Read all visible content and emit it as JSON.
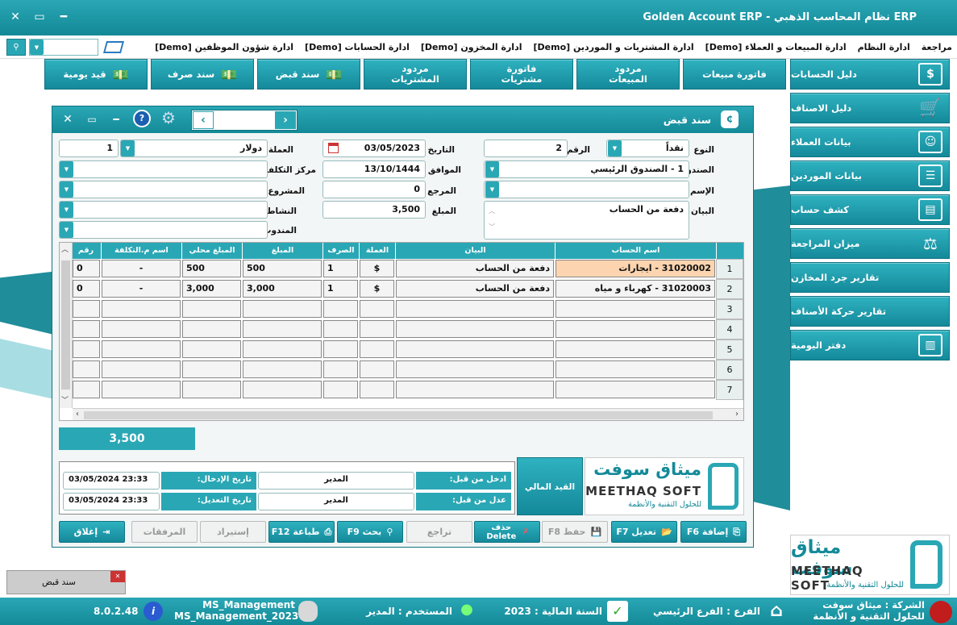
{
  "window": {
    "title": "ERP نظام المحاسب الذهبي - Golden Account ERP"
  },
  "menu": {
    "items": [
      "ادارة شؤون الموظفين [Demo]",
      "ادارة الحسابات [Demo]",
      "ادارة المخزون [Demo]",
      "ادارة المشتريات و الموردين [Demo]",
      "ادارة المبيعات و العملاء [Demo]",
      "ادارة النظام",
      "مراجعة"
    ]
  },
  "toolbar": {
    "tiles": [
      "فاتورة مبيعات",
      "مردود المبيعات",
      "فاتورة مشتريات",
      "مردود المشتريات",
      "سند قبض",
      "سند صرف",
      "قيد يومية"
    ]
  },
  "sidebar": {
    "items": [
      "دليل الحسابات",
      "دليل الاصناف",
      "بيانات العملاء",
      "بيانات الموردين",
      "كشف حساب",
      "ميزان المراجعة",
      "تقارير جرد المخازن",
      "تقارير حركة الأصناف",
      "دفتر اليومية"
    ]
  },
  "dialog": {
    "title": "سند قبض",
    "record_no": "2",
    "labels": {
      "type": "النوع",
      "number": "الرقم",
      "date": "التاريخ",
      "currency": "العملة",
      "box": "الصندوق",
      "hijri": "الموافق",
      "cost_center": "مركز التكلفة",
      "name": "الإسم",
      "ref": "المرجع",
      "project": "المشروع",
      "statement": "البيان",
      "amount": "المبلغ",
      "activity": "النشاط",
      "delegate": "المندوب"
    },
    "values": {
      "type": "نقداً",
      "number": "2",
      "date": "03/05/2023",
      "currency": "دولار",
      "currency_rate": "1",
      "box": "1 - الصندوق الرئيسي",
      "hijri": "13/10/1444",
      "ref": "0",
      "amount": "3,500",
      "statement": "دفعة من الحساب"
    },
    "grid": {
      "headers": [
        "اسم الحساب",
        "البيان",
        "العملة",
        "الصرف",
        "المبلغ",
        "المبلغ محلي",
        "اسم م.التكلفة",
        "رقم"
      ],
      "rows": [
        {
          "n": "1",
          "account": "31020002 - ايجارات",
          "statement": "دفعة من الحساب",
          "currency": "$",
          "rate": "1",
          "amount": "500",
          "local": "500",
          "cost": "-",
          "num": "0"
        },
        {
          "n": "2",
          "account": "31020003 - كهرباء و مياه",
          "statement": "دفعة من الحساب",
          "currency": "$",
          "rate": "1",
          "amount": "3,000",
          "local": "3,000",
          "cost": "-",
          "num": "0"
        },
        {
          "n": "3"
        },
        {
          "n": "4"
        },
        {
          "n": "5"
        },
        {
          "n": "6"
        },
        {
          "n": "7"
        }
      ]
    },
    "total": "3,500",
    "audit": {
      "entered_by_label": "ادخل من قبل:",
      "entered_by": "المدير",
      "entry_date_label": "تاريخ الإدخال:",
      "entry_date": "03/05/2024 23:33",
      "edited_by_label": "عدل من قبل:",
      "edited_by": "المدير",
      "edit_date_label": "تاريخ التعديل:",
      "edit_date": "03/05/2024 23:33",
      "finance_entry": "القيد المالي"
    },
    "buttons": {
      "add": "إضافة F6",
      "edit": "تعديل F7",
      "save": "حفظ F8",
      "delete": "حذف Delete",
      "revert": "تراجع",
      "search": "بحث F9",
      "print": "طباعة F12",
      "import": "إستيراد",
      "attachments": "المرفقات",
      "close": "إغلاق"
    }
  },
  "logo": {
    "ar": "ميثاق سوفت",
    "en": "MEETHAQ SOFT",
    "tagline": "للحلول التقنية والأنظمة"
  },
  "taskbar_item": "سند قبض",
  "status": {
    "company": "الشركة : ميثاق سوفت للحلول التقنية و الأنظمة",
    "branch": "الفرع : الفرع الرئيسي",
    "year": "السنة المالية : 2023",
    "user": "المستخدم : المدير",
    "db1": "MS_Management",
    "db2": "MS_Management_2023",
    "version": "8.0.2.48"
  },
  "colors": {
    "accent": "#2aa7b5",
    "dark": "#14899a",
    "highlight": "#fcd5b0"
  }
}
